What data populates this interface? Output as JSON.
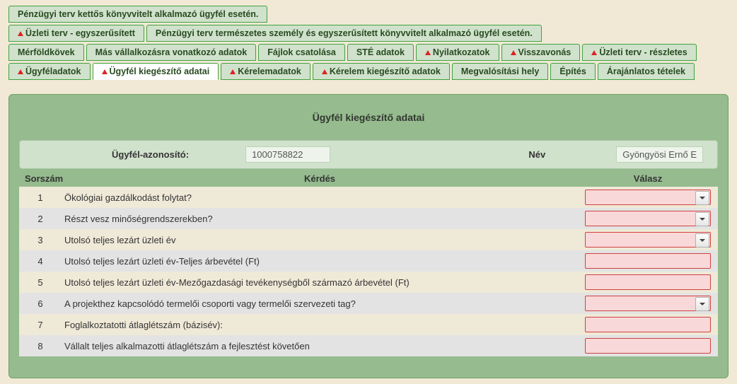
{
  "tabs": {
    "row1": [
      {
        "label": "Pénzügyi terv kettős könyvvitelt alkalmazó ügyfél esetén.",
        "warn": false
      }
    ],
    "row2": [
      {
        "label": "Üzleti terv - egyszerűsített",
        "warn": true
      },
      {
        "label": "Pénzügyi terv természetes személy és egyszerűsített könyvvitelt alkalmazó ügyfél esetén.",
        "warn": false
      }
    ],
    "row3": [
      {
        "label": "Mérföldkövek",
        "warn": false
      },
      {
        "label": "Más vállalkozásra vonatkozó adatok",
        "warn": false
      },
      {
        "label": "Fájlok csatolása",
        "warn": false
      },
      {
        "label": "STÉ adatok",
        "warn": false
      },
      {
        "label": "Nyilatkozatok",
        "warn": true
      },
      {
        "label": "Visszavonás",
        "warn": true
      },
      {
        "label": "Üzleti terv - részletes",
        "warn": true
      }
    ],
    "row4": [
      {
        "label": "Ügyféladatok",
        "warn": true,
        "active": false
      },
      {
        "label": "Ügyfél kiegészítő adatai",
        "warn": true,
        "active": true
      },
      {
        "label": "Kérelemadatok",
        "warn": true
      },
      {
        "label": "Kérelem kiegészítő adatok",
        "warn": true
      },
      {
        "label": "Megvalósítási hely",
        "warn": false
      },
      {
        "label": "Építés",
        "warn": false
      },
      {
        "label": "Árajánlatos tételek",
        "warn": false
      }
    ]
  },
  "panel": {
    "title": "Ügyfél kiegészítő adatai",
    "id_label": "Ügyfél-azonosító:",
    "id_value": "1000758822",
    "name_label": "Név",
    "name_value": "Gyöngyösi Ernő E"
  },
  "columns": {
    "c1": "Sorszám",
    "c2": "Kérdés",
    "c3": "Válasz"
  },
  "rows": [
    {
      "n": "1",
      "q": "Ökológiai gazdálkodást folytat?",
      "type": "select"
    },
    {
      "n": "2",
      "q": "Részt vesz minőségrendszerekben?",
      "type": "select"
    },
    {
      "n": "3",
      "q": "Utolsó teljes lezárt üzleti év",
      "type": "select"
    },
    {
      "n": "4",
      "q": "Utolsó teljes lezárt üzleti év-Teljes árbevétel (Ft)",
      "type": "text"
    },
    {
      "n": "5",
      "q": "Utolsó teljes lezárt üzleti év-Mezőgazdasági tevékenységből származó árbevétel (Ft)",
      "type": "text"
    },
    {
      "n": "6",
      "q": "A projekthez kapcsolódó termelői csoporti vagy termelői szervezeti tag?",
      "type": "select"
    },
    {
      "n": "7",
      "q": "Foglalkoztatotti átlaglétszám (bázisév):",
      "type": "text"
    },
    {
      "n": "8",
      "q": "Vállalt teljes alkalmazotti átlaglétszám a fejlesztést követően",
      "type": "text"
    }
  ]
}
